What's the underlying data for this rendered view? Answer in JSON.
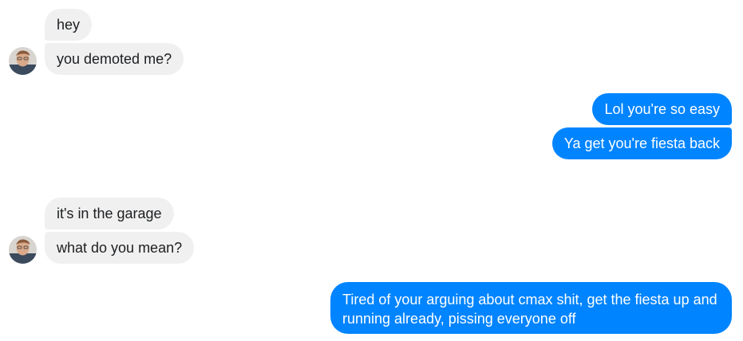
{
  "conversation": {
    "messages": [
      {
        "from": "contact",
        "text": "hey"
      },
      {
        "from": "contact",
        "text": "you demoted me?"
      },
      {
        "from": "me",
        "text": "Lol you're so easy"
      },
      {
        "from": "me",
        "text": "Ya get you're fiesta back"
      },
      {
        "from": "contact",
        "text": "it's in the garage"
      },
      {
        "from": "contact",
        "text": "what do you mean?"
      },
      {
        "from": "me",
        "text": "Tired of your arguing about cmax shit, get the fiesta up and running already, pissing everyone off"
      }
    ]
  },
  "colors": {
    "outgoing_bubble": "#0084ff",
    "incoming_bubble": "#f0f0f0",
    "incoming_text": "#1c1e21",
    "outgoing_text": "#ffffff"
  }
}
